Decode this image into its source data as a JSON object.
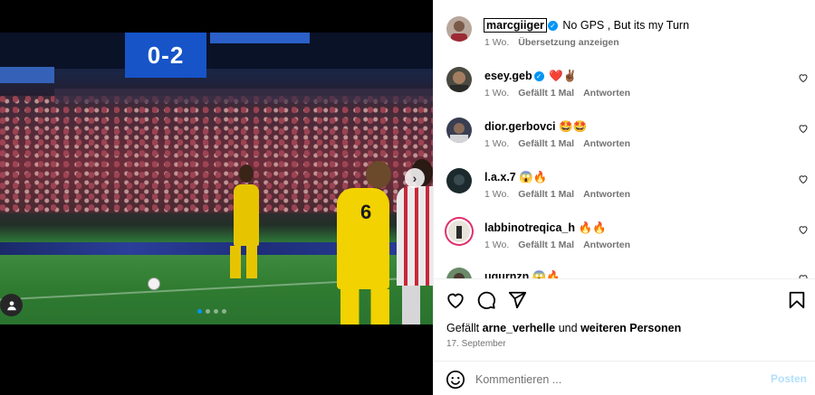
{
  "post": {
    "author": "marcgiiger",
    "caption": "No GPS , But its my Turn",
    "time": "1 Wo.",
    "translate_label": "Übersetzung anzeigen",
    "scoreboard_text": "0-2",
    "slide_count": 4,
    "active_slide": 1
  },
  "comments": [
    {
      "user": "esey.geb",
      "verified": true,
      "text": "❤️✌🏾",
      "time": "1 Wo.",
      "likes": "Gefällt 1 Mal",
      "reply": "Antworten"
    },
    {
      "user": "dior.gerbovci",
      "verified": false,
      "text": "🤩🤩",
      "time": "1 Wo.",
      "likes": "Gefällt 1 Mal",
      "reply": "Antworten"
    },
    {
      "user": "l.a.x.7",
      "verified": false,
      "text": "😱🔥",
      "time": "1 Wo.",
      "likes": "Gefällt 1 Mal",
      "reply": "Antworten"
    },
    {
      "user": "labbinotreqica_h",
      "verified": false,
      "text": "🔥🔥",
      "time": "1 Wo.",
      "likes": "Gefällt 1 Mal",
      "reply": "Antworten"
    },
    {
      "user": "ugurnzn",
      "verified": false,
      "text": "😱🔥",
      "time": "",
      "likes": "",
      "reply": ""
    }
  ],
  "liked_by": {
    "prefix": "Gefällt",
    "user": "arne_verhelle",
    "joiner": "und",
    "others": "weiteren Personen"
  },
  "date": "17. September",
  "comment_box": {
    "placeholder": "Kommentieren ...",
    "post_label": "Posten"
  },
  "icons": {
    "like": "heart-icon",
    "comment": "comment-icon",
    "share": "share-icon",
    "save": "bookmark-icon",
    "emoji": "emoji-icon",
    "next": "chevron-right-icon",
    "tagged": "user-tag-icon"
  },
  "colors": {
    "accent": "#0095f6",
    "muted": "#737373",
    "post_disabled": "#b2dffc"
  }
}
